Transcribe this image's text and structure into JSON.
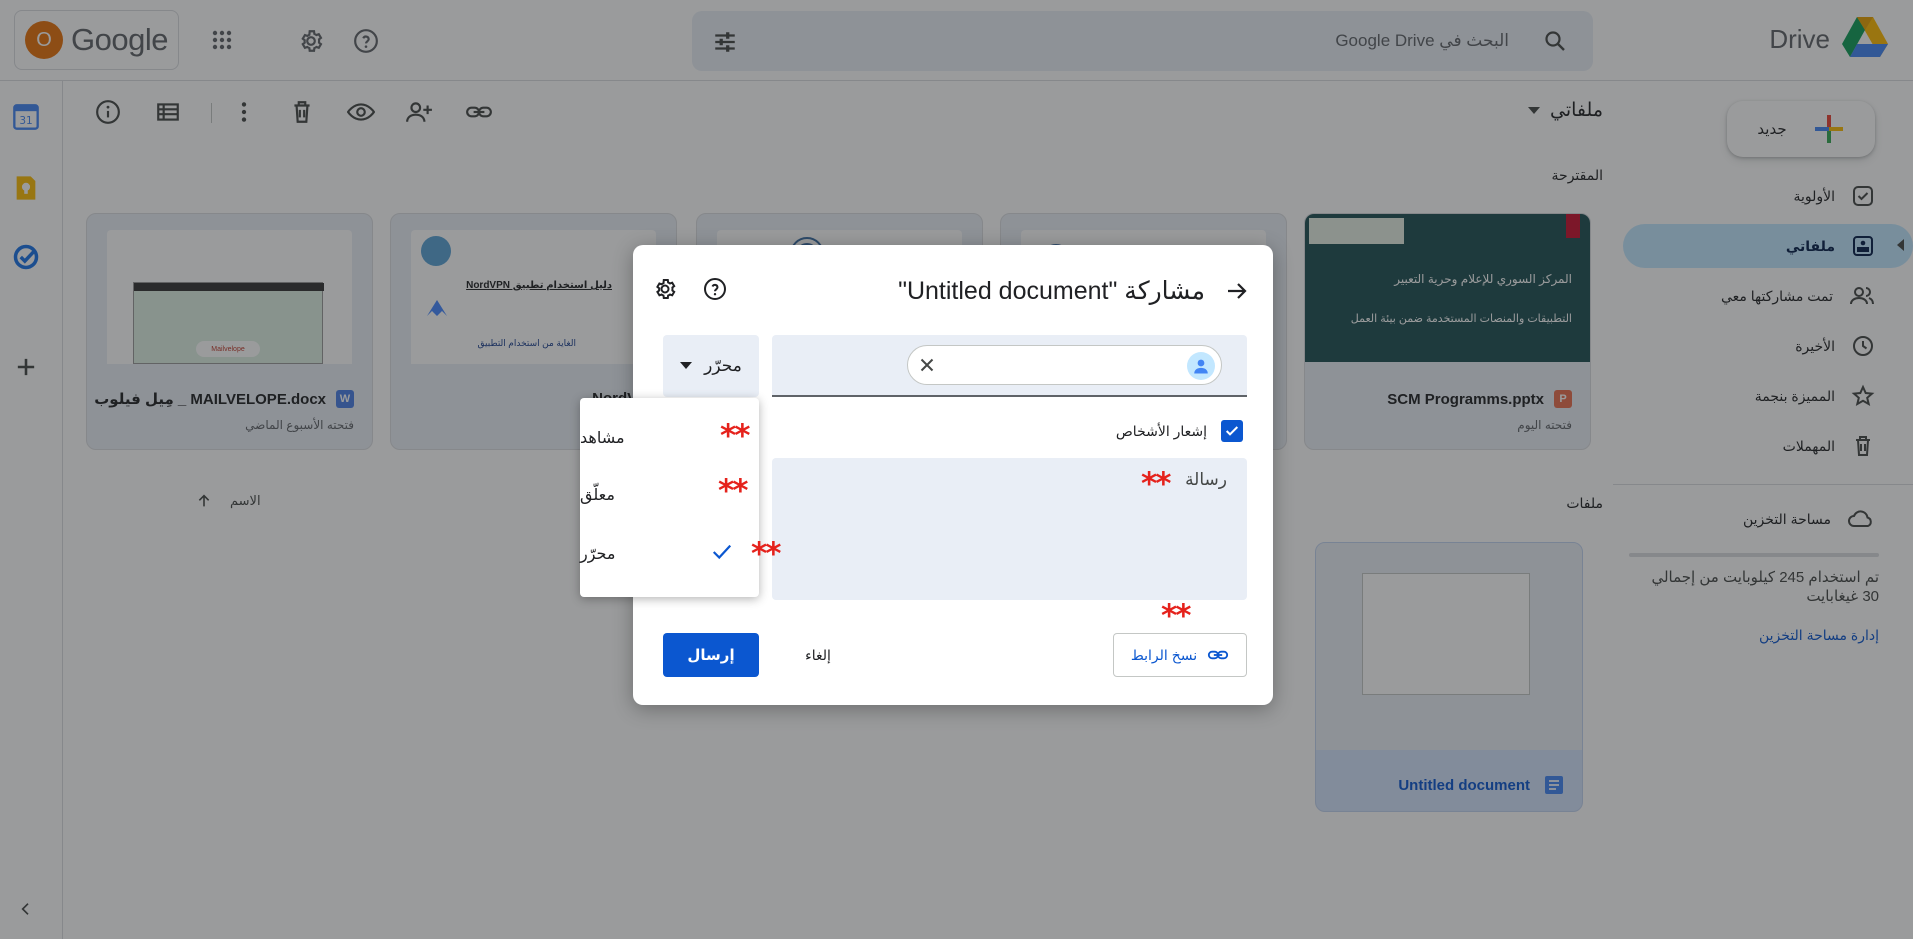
{
  "app": {
    "brand": "Drive",
    "google_word": "Google",
    "avatar_letter": "O"
  },
  "search": {
    "placeholder": "البحث في Google Drive"
  },
  "sidebar": {
    "new_label": "جديد",
    "items": [
      {
        "label": "الأولوية",
        "icon": "priority-icon"
      },
      {
        "label": "ملفاتي",
        "icon": "my-drive-icon",
        "active": true
      },
      {
        "label": "تمت مشاركتها معي",
        "icon": "shared-icon"
      },
      {
        "label": "الأخيرة",
        "icon": "clock-icon"
      },
      {
        "label": "المميزة بنجمة",
        "icon": "star-icon"
      },
      {
        "label": "المهملات",
        "icon": "trash-icon"
      }
    ],
    "storage_label": "مساحة التخزين",
    "storage_text": "تم استخدام 245 كيلوبايت من إجمالي 30 غيغابايت",
    "storage_link": "إدارة مساحة التخزين"
  },
  "main": {
    "breadcrumb": "ملفاتي",
    "suggested_label": "المقترحة",
    "files_label": "ملفات",
    "sort_label": "الاسم",
    "cards": [
      {
        "title": "SCM Programms.pptx",
        "sub": "فتحته اليوم",
        "type": "P"
      },
      {
        "title": "",
        "sub": "",
        "type": ""
      },
      {
        "title": "",
        "sub": "",
        "type": ""
      },
      {
        "title": "NordVPN",
        "sub": "",
        "type": ""
      },
      {
        "title": "مِيل فيلوب _ MAILVELOPE.docx",
        "sub": "فتحته الأسبوع الماضي",
        "type": "W"
      }
    ],
    "card0_thumb": [
      "المركز السوري للإعلام وحرية التعبير",
      "التطبيقات والمنصات المستخدمة ضمن بيئة العمل"
    ],
    "card3_thumb": [
      "دليل استخدام تطبيق NordVPN",
      "الغاية من استخدام التطبيق"
    ],
    "card4_thumb": [
      "Mailvelope"
    ],
    "file_card": {
      "title": "Untitled document"
    }
  },
  "dialog": {
    "title": "مشاركة \"Untitled document\"",
    "role_label": "محرّر",
    "notify_label": "إشعار الأشخاص",
    "message_placeholder": "رسالة",
    "copy_link": "نسخ الرابط",
    "cancel": "إلغاء",
    "send": "إرسال"
  },
  "role_menu": {
    "options": [
      "مشاهد",
      "معلّق",
      "محرّر"
    ],
    "selected": "محرّر"
  },
  "annotations": {
    "mark": "**"
  },
  "colors": {
    "accent": "#0b57d0",
    "active_nav": "#c2e7ff",
    "search_bg": "#e9eef6",
    "annotation": "#e5221c"
  }
}
